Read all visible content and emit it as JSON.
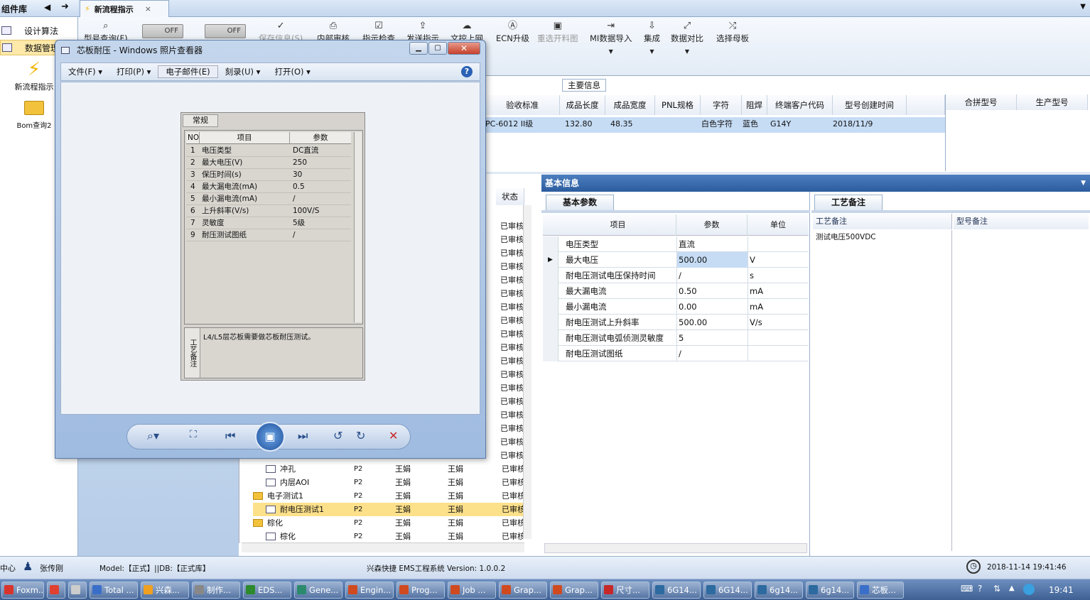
{
  "sidebar": {
    "header": "组件库",
    "items": [
      {
        "label": "设计算法"
      },
      {
        "label": "数据管理"
      }
    ],
    "tiles": [
      {
        "label": "新流程指示"
      },
      {
        "label": "Bom查询2"
      }
    ]
  },
  "app_tab": {
    "label": "新流程指示",
    "close": "×"
  },
  "toolbar": {
    "toggles": [
      {
        "label": "OFF"
      },
      {
        "label": "OFF"
      }
    ],
    "buttons": [
      {
        "label": "型号查询(F)",
        "icon": "search-icon"
      },
      {
        "label": "保存信息(S)",
        "icon": "check-icon",
        "disabled": true
      },
      {
        "label": "内部审核",
        "icon": "print-icon"
      },
      {
        "label": "指示检查",
        "icon": "check-icon"
      },
      {
        "label": "发送指示",
        "icon": "upload-icon"
      },
      {
        "label": "文控上网",
        "icon": "cloud-icon"
      },
      {
        "label": "ECN升级",
        "icon": "ecn-icon"
      },
      {
        "label": "重选开料图",
        "icon": "image-icon",
        "disabled": true
      },
      {
        "label": "MI数据导入",
        "icon": "import-icon"
      },
      {
        "label": "集成",
        "icon": "download-icon"
      },
      {
        "label": "数据对比",
        "icon": "compare-icon"
      },
      {
        "label": "选择母板",
        "icon": "shuffle-icon"
      }
    ]
  },
  "main_info": {
    "label": "主要信息",
    "columns": [
      "验收标准",
      "成品长度",
      "成品宽度",
      "PNL规格",
      "字符",
      "阻焊",
      "终端客户代码",
      "型号创建时间"
    ],
    "row": [
      "PC-6012 II级",
      "132.80",
      "48.35",
      "",
      "白色字符",
      "蓝色",
      "G14Y",
      "2018/11/9"
    ],
    "side_columns": [
      "合拼型号",
      "生产型号"
    ]
  },
  "process_tree": {
    "status_header": "状态",
    "status_value": "已审核",
    "rows": [
      {
        "name": "冲孔",
        "level": "P2",
        "a": "王娟",
        "b": "王娟",
        "status": "已审核",
        "folder": false,
        "selected": false
      },
      {
        "name": "内层AOI",
        "level": "P2",
        "a": "王娟",
        "b": "王娟",
        "status": "已审核",
        "folder": false,
        "selected": false
      },
      {
        "name": "电子测试1",
        "level": "P2",
        "a": "王娟",
        "b": "王娟",
        "status": "已审核",
        "folder": true,
        "selected": false
      },
      {
        "name": "耐电压测试1",
        "level": "P2",
        "a": "王娟",
        "b": "王娟",
        "status": "已审核",
        "folder": false,
        "selected": true
      },
      {
        "name": "棕化",
        "level": "P2",
        "a": "王娟",
        "b": "王娟",
        "status": "已审核",
        "folder": true,
        "selected": false
      },
      {
        "name": "棕化",
        "level": "P2",
        "a": "王娟",
        "b": "王娟",
        "status": "已审核",
        "folder": false,
        "selected": false
      }
    ]
  },
  "basic_info": {
    "header": "基本信息",
    "tab": "基本参数",
    "columns": [
      "项目",
      "参数",
      "单位"
    ],
    "rows": [
      {
        "item": "电压类型",
        "value": "直流",
        "unit": ""
      },
      {
        "item": "最大电压",
        "value": "500.00",
        "unit": "V"
      },
      {
        "item": "耐电压测试电压保持时间",
        "value": "/",
        "unit": "s"
      },
      {
        "item": "最大漏电流",
        "value": "0.50",
        "unit": "mA"
      },
      {
        "item": "最小漏电流",
        "value": "0.00",
        "unit": "mA"
      },
      {
        "item": "耐电压测试上升斜率",
        "value": "500.00",
        "unit": "V/s"
      },
      {
        "item": "耐电压测试电弧侦测灵敏度",
        "value": "5",
        "unit": ""
      },
      {
        "item": "耐电压测试图纸",
        "value": "/",
        "unit": ""
      }
    ]
  },
  "process_notes": {
    "tab": "工艺备注",
    "col1": "工艺备注",
    "col2": "型号备注",
    "note": "测试电压500VDC"
  },
  "viewer": {
    "title": "芯板耐压 - Windows 照片查看器",
    "menu": [
      "文件(F)",
      "打印(P)",
      "电子邮件(E)",
      "刻录(U)",
      "打开(O)"
    ],
    "help": "?",
    "shot": {
      "tab": "常规",
      "columns": [
        "NO",
        "项目",
        "参数"
      ],
      "rows": [
        {
          "no": "1",
          "item": "电压类型",
          "value": "DC直流"
        },
        {
          "no": "2",
          "item": "最大电压(V)",
          "value": "250"
        },
        {
          "no": "3",
          "item": "保压时间(s)",
          "value": "30"
        },
        {
          "no": "4",
          "item": "最大漏电流(mA)",
          "value": "0.5"
        },
        {
          "no": "5",
          "item": "最小漏电流(mA)",
          "value": "/"
        },
        {
          "no": "6",
          "item": "上升斜率(V/s)",
          "value": "100V/S"
        },
        {
          "no": "7",
          "item": "灵敏度",
          "value": "5级"
        },
        {
          "no": "9",
          "item": "耐压测试图纸",
          "value": "/"
        }
      ],
      "remark_label": "工艺备注",
      "remark": "L4/L5层芯板需要做芯板耐压测试。"
    }
  },
  "status": {
    "left": "中心",
    "user": "张传刚",
    "model": "Model:【正式】||DB:【正式库】",
    "system": "兴森快捷 EMS工程系统 Version: 1.0.0.2",
    "datetime": "2018-11-14 19:41:46"
  },
  "taskbar": {
    "tasks": [
      {
        "label": "Foxm...",
        "color": "#d9342b"
      },
      {
        "label": "",
        "color": "#e04030"
      },
      {
        "label": "",
        "color": "#cccccc"
      },
      {
        "label": "Total ...",
        "color": "#3a6fc9"
      },
      {
        "label": "兴森...",
        "color": "#f0a020"
      },
      {
        "label": "制作...",
        "color": "#888888"
      },
      {
        "label": "EDS...",
        "color": "#2c8a2c"
      },
      {
        "label": "Gene...",
        "color": "#2c8a6c"
      },
      {
        "label": "Engin...",
        "color": "#d04a20"
      },
      {
        "label": "Prog...",
        "color": "#d04a20"
      },
      {
        "label": "Job ...",
        "color": "#d04a20"
      },
      {
        "label": "Grap...",
        "color": "#d04a20"
      },
      {
        "label": "Grap...",
        "color": "#d04a20"
      },
      {
        "label": "尺寸...",
        "color": "#c62828"
      },
      {
        "label": "6G14...",
        "color": "#2c6aa0"
      },
      {
        "label": "6G14...",
        "color": "#2c6aa0"
      },
      {
        "label": "6g14...",
        "color": "#2c6aa0"
      },
      {
        "label": "6g14...",
        "color": "#2c6aa0"
      },
      {
        "label": "芯板...",
        "color": "#3a6fc9"
      }
    ],
    "clock": "19:41"
  }
}
